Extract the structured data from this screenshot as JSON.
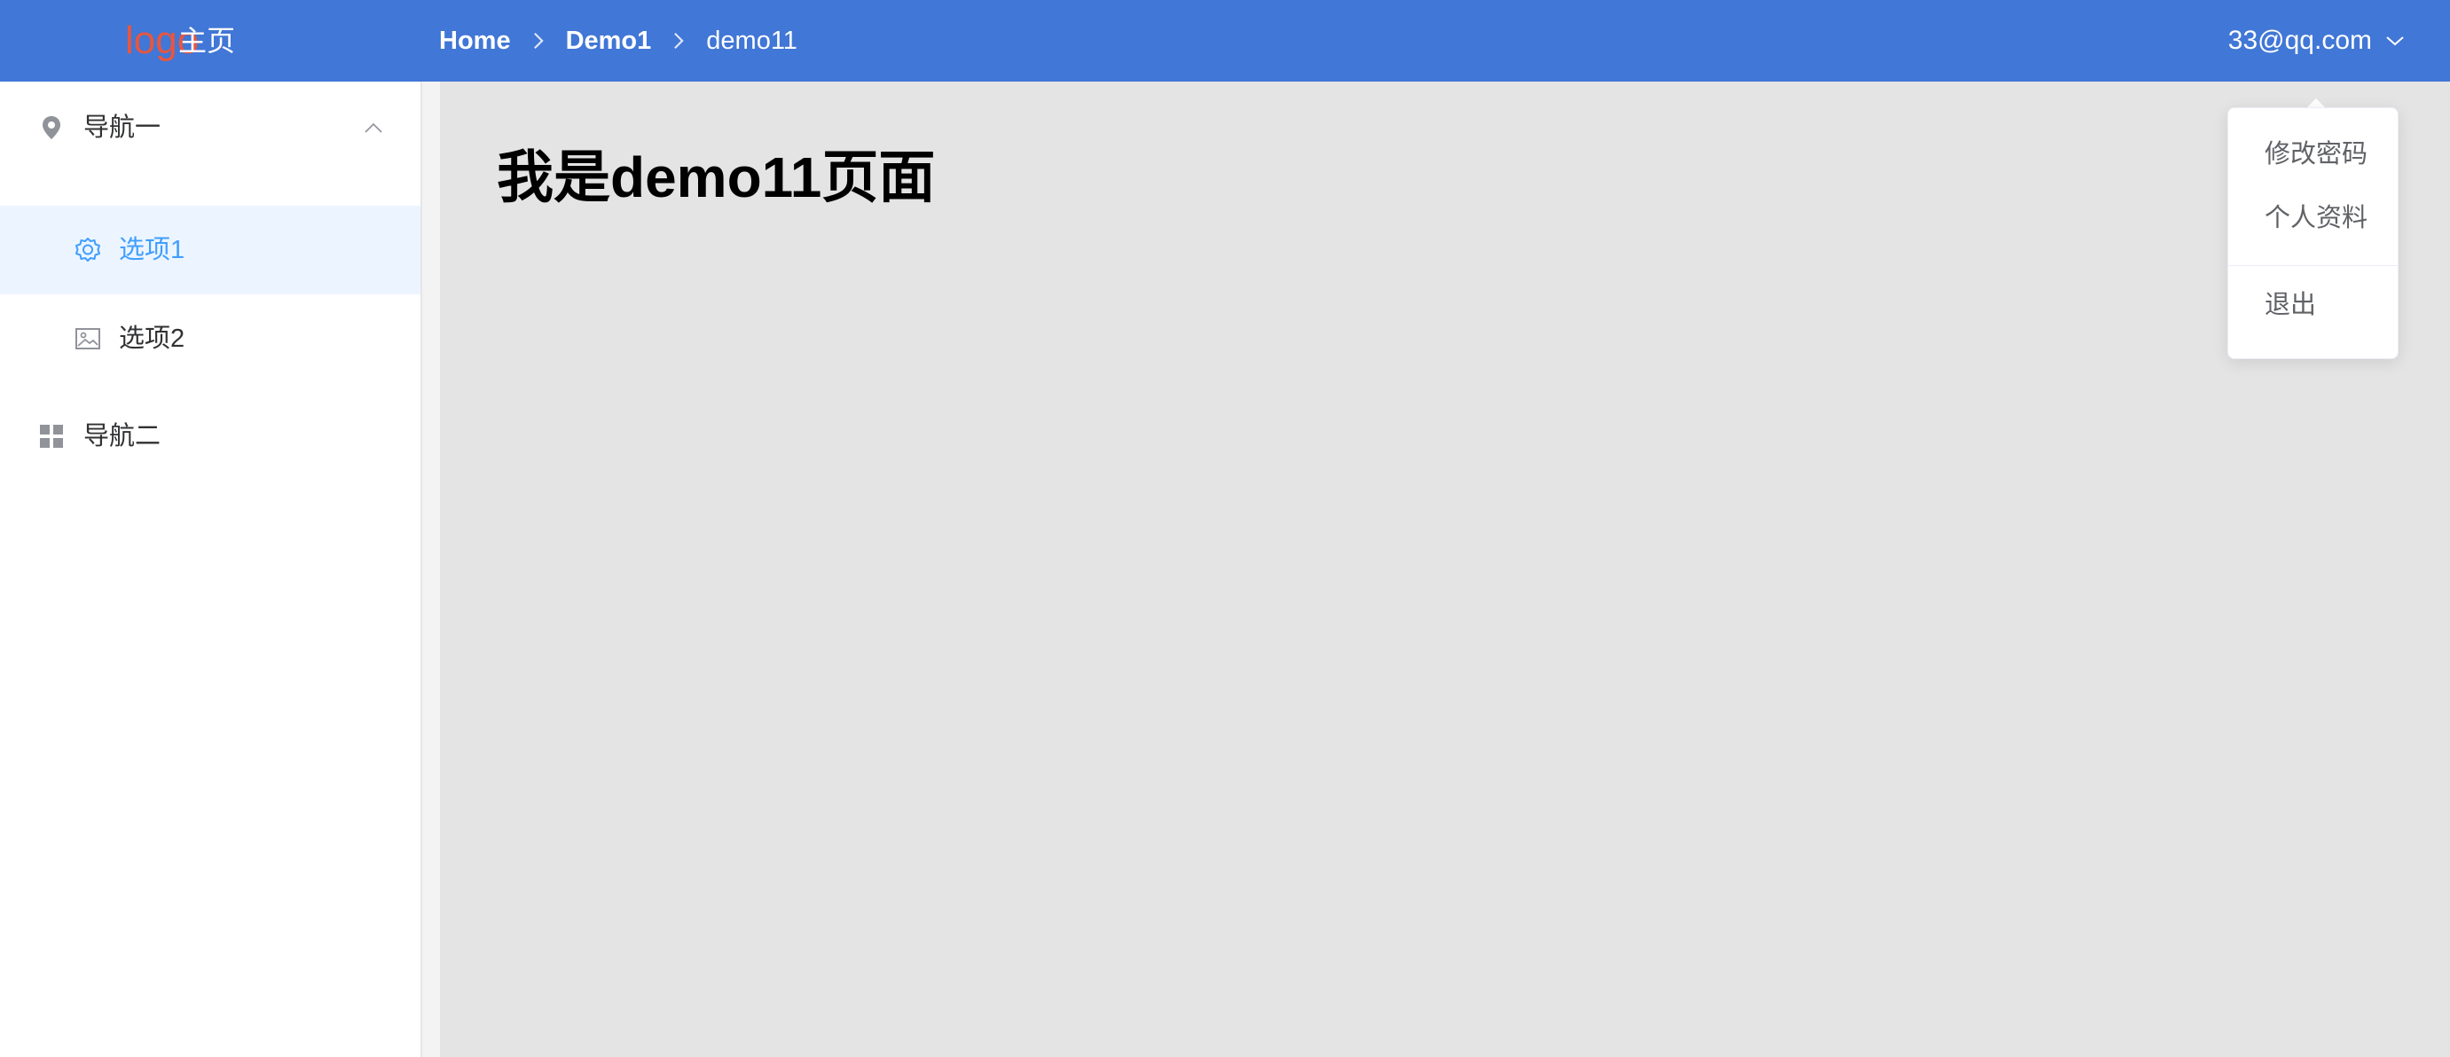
{
  "header": {
    "logo_text": "logo",
    "home_label": "主页",
    "breadcrumb": [
      "Home",
      "Demo1",
      "demo11"
    ],
    "user_email": "33@qq.com"
  },
  "sidebar": {
    "groups": [
      {
        "label": "导航一",
        "icon": "location-pin-icon",
        "expanded": true
      },
      {
        "label": "导航二",
        "icon": "grid-icon",
        "expanded": false
      }
    ],
    "items": [
      {
        "label": "选项1",
        "icon": "gear-icon",
        "active": true
      },
      {
        "label": "选项2",
        "icon": "image-icon",
        "active": false
      }
    ]
  },
  "main": {
    "title": "我是demo11页面"
  },
  "user_dropdown": {
    "items": [
      "修改密码",
      "个人资料",
      "退出"
    ]
  },
  "colors": {
    "header_bg": "#4177d6",
    "logo": "#e8563f",
    "active_text": "#409eff",
    "active_bg": "#ecf5ff",
    "main_bg": "#e4e4e4"
  }
}
